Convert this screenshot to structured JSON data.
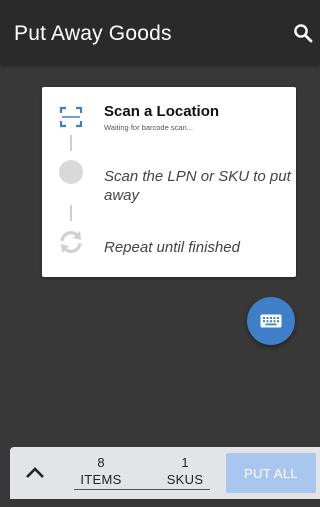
{
  "app_bar": {
    "title": "Put Away Goods",
    "search_icon": "search-icon"
  },
  "steps": [
    {
      "icon": "barcode-scan-icon",
      "title": "Scan a Location",
      "subtitle": "Waiting for barcode scan..."
    },
    {
      "icon": "circle-icon",
      "text": "Scan the LPN or SKU to put away"
    },
    {
      "icon": "repeat-icon",
      "text": "Repeat until finished"
    }
  ],
  "fab": {
    "icon": "keyboard-icon"
  },
  "bottom_bar": {
    "expand_icon": "chevron-up-icon",
    "items_count": "8",
    "items_label": "ITEMS",
    "skus_count": "1",
    "skus_label": "SKUS",
    "put_all_label": "PUT ALL"
  },
  "colors": {
    "app_bar": "#2a2a2a",
    "background": "#383838",
    "accent": "#3f7fc8",
    "put_all_disabled": "#a9c6ee",
    "bottom_bar": "#e3e4e8"
  }
}
